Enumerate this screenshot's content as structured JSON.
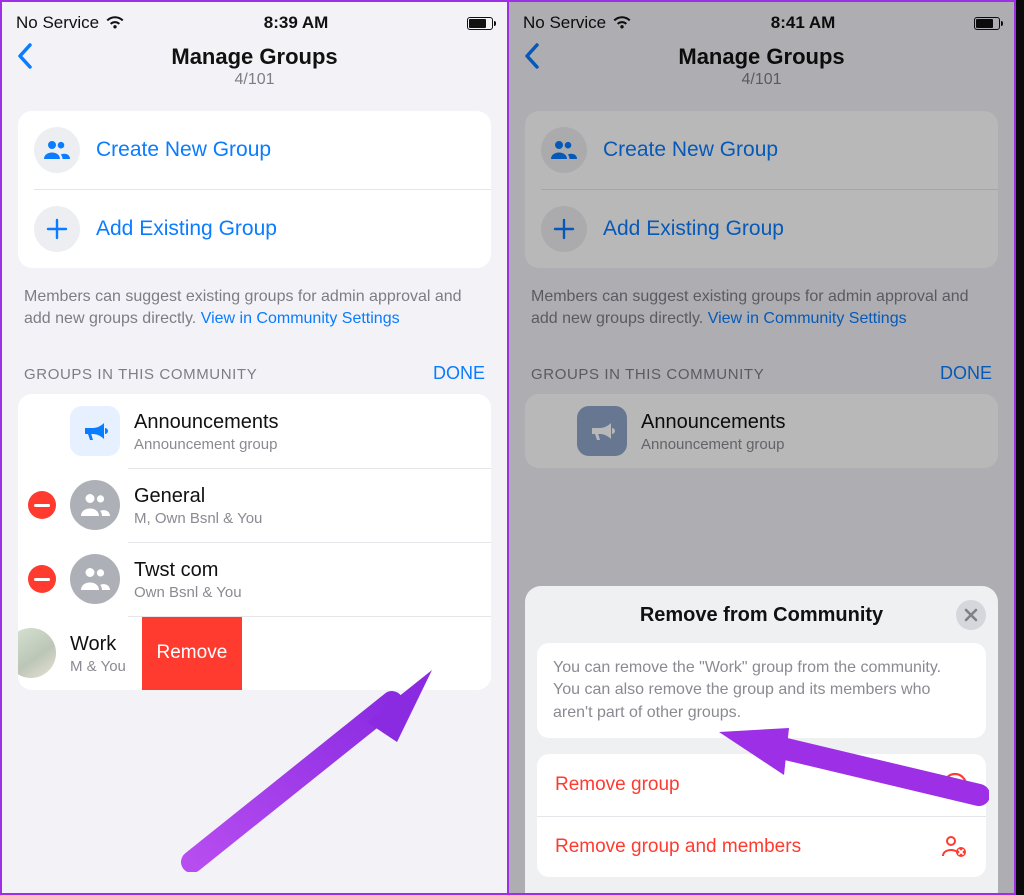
{
  "left": {
    "status": {
      "carrier": "No Service",
      "time": "8:39 AM"
    },
    "nav": {
      "title": "Manage Groups",
      "sub": "4/101"
    },
    "actions": {
      "create": "Create New Group",
      "add": "Add Existing Group"
    },
    "note": {
      "text": "Members can suggest existing groups for admin approval and add new groups directly. ",
      "link": "View in Community Settings"
    },
    "section": {
      "title": "GROUPS IN THIS COMMUNITY",
      "done": "DONE"
    },
    "groups": [
      {
        "name": "Announcements",
        "sub": "Announcement group"
      },
      {
        "name": "General",
        "sub": "M, Own Bsnl & You"
      },
      {
        "name": "Twst com",
        "sub": "Own Bsnl & You"
      },
      {
        "name": "Work",
        "sub": "M & You"
      }
    ],
    "swipe_label": "Remove"
  },
  "right": {
    "status": {
      "carrier": "No Service",
      "time": "8:41 AM"
    },
    "nav": {
      "title": "Manage Groups",
      "sub": "4/101"
    },
    "actions": {
      "create": "Create New Group",
      "add": "Add Existing Group"
    },
    "note": {
      "text": "Members can suggest existing groups for admin approval and add new groups directly. ",
      "link": "View in Community Settings"
    },
    "section": {
      "title": "GROUPS IN THIS COMMUNITY",
      "done": "DONE"
    },
    "group0": {
      "name": "Announcements",
      "sub": "Announcement group"
    },
    "sheet": {
      "title": "Remove from Community",
      "desc": "You can remove the \"Work\" group from the community. You can also remove the group and its members who aren't part of other groups.",
      "act1": "Remove group",
      "act2": "Remove group and members"
    }
  }
}
